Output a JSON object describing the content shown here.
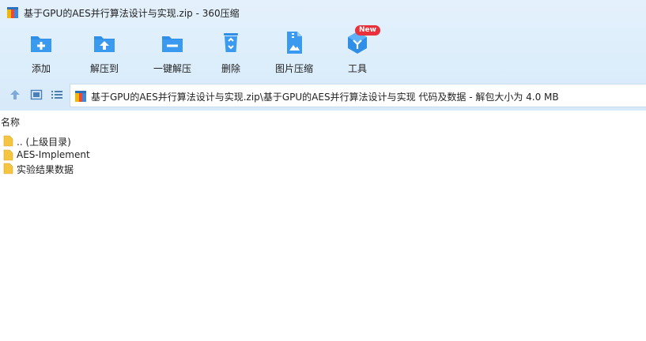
{
  "window": {
    "title": "基于GPU的AES并行算法设计与实现.zip - 360压缩"
  },
  "toolbar": {
    "add_label": "添加",
    "extract_to_label": "解压到",
    "one_click_extract_label": "一键解压",
    "delete_label": "删除",
    "image_compress_label": "图片压缩",
    "tools_label": "工具",
    "tools_badge": "New"
  },
  "address": {
    "path": "基于GPU的AES并行算法设计与实现.zip\\基于GPU的AES并行算法设计与实现 代码及数据 - 解包大小为 4.0 MB"
  },
  "list": {
    "column_name": "名称",
    "items": [
      {
        "label": ".. (上级目录)"
      },
      {
        "label": "AES-Implement"
      },
      {
        "label": "实验结果数据"
      }
    ]
  },
  "colors": {
    "toolbar_icon": "#2e8ee8",
    "header_bg": "#dcedfb",
    "badge": "#e8313a",
    "folder": "#f5c542"
  }
}
